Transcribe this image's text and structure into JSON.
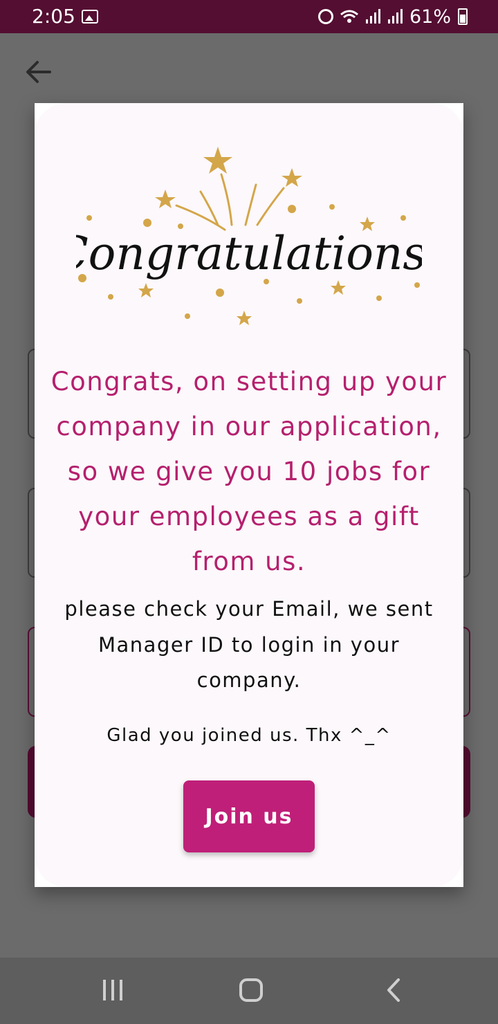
{
  "status_bar": {
    "time": "2:05",
    "battery": "61%",
    "icons": [
      "gallery-icon",
      "alarm-icon",
      "wifi-icon",
      "signal-icon",
      "signal-icon",
      "battery-icon"
    ]
  },
  "background_screen": {
    "back_icon": "arrow-left-icon"
  },
  "dialog": {
    "headline_image_text": "Congratulations!",
    "message": "Congrats, on setting up your company in our application, so we give you 10 jobs for your employees as a gift from us.",
    "note": "please check your Email, we sent Manager ID to login in your company.",
    "thanks": "Glad you joined us. Thx ^_^",
    "button_label": "Join us"
  },
  "colors": {
    "brand_dark": "#540e32",
    "accent": "#bf1f78",
    "message_text": "#b5206e",
    "confetti": "#d4a64a"
  },
  "nav_bar": {
    "icons": [
      "recent-apps-icon",
      "home-icon",
      "back-icon"
    ]
  }
}
